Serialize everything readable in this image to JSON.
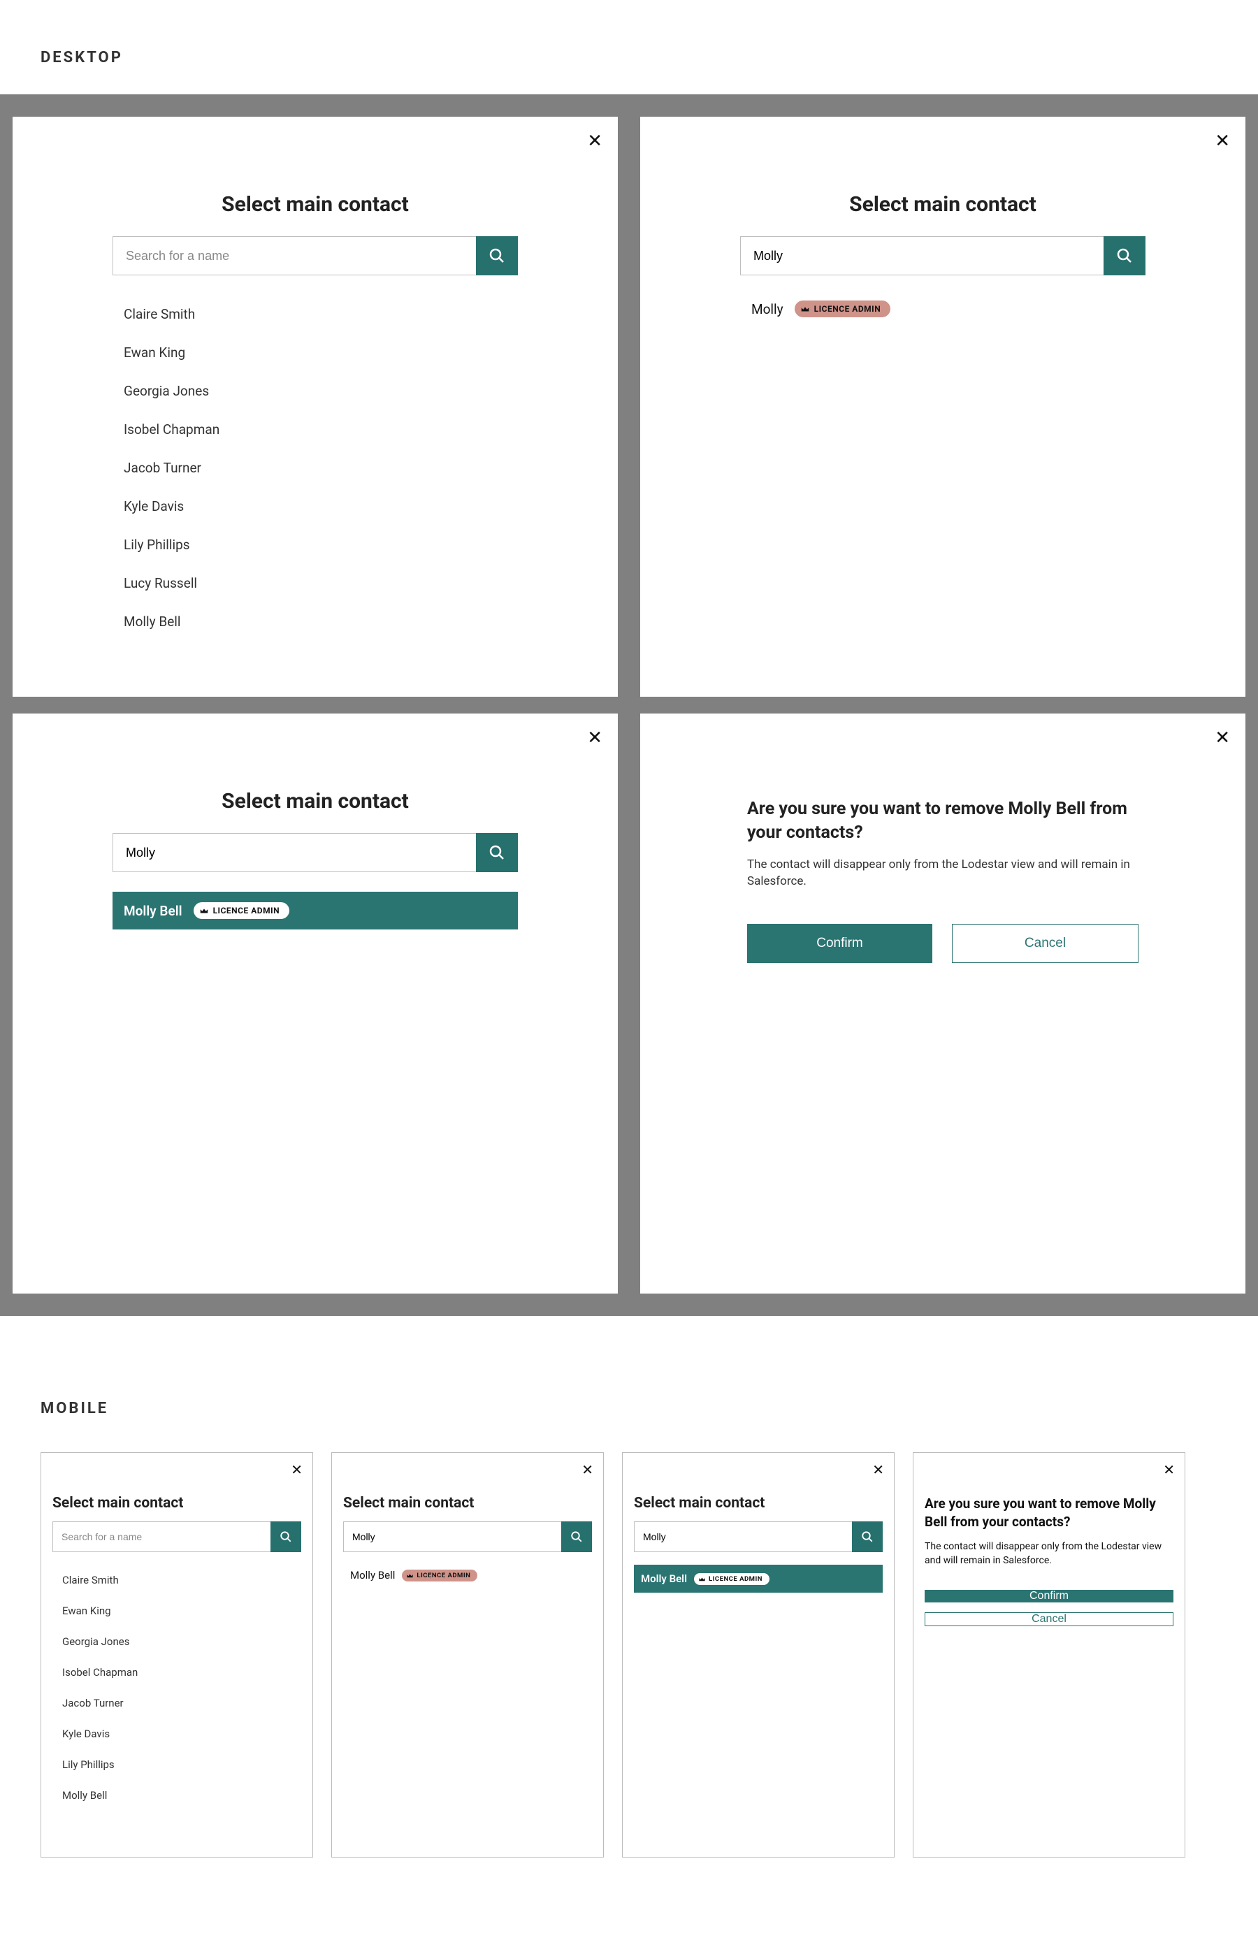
{
  "labels": {
    "desktop": "DESKTOP",
    "mobile": "MOBILE"
  },
  "selectContact": {
    "title": "Select main contact",
    "placeholder": "Search for a name",
    "query": "Molly",
    "badgeText": "LICENCE ADMIN",
    "contacts": [
      "Claire Smith",
      "Ewan King",
      "Georgia Jones",
      "Isobel Chapman",
      "Jacob Turner",
      "Kyle Davis",
      "Lily Phillips",
      "Lucy Russell",
      "Molly Bell"
    ],
    "resultShort": "Molly",
    "resultFull": "Molly Bell"
  },
  "confirmDialog": {
    "title": "Are you sure you want to remove Molly Bell from your contacts?",
    "body": "The contact will disappear only from the Lodestar view and will remain in Salesforce.",
    "confirm": "Confirm",
    "cancel": "Cancel"
  }
}
